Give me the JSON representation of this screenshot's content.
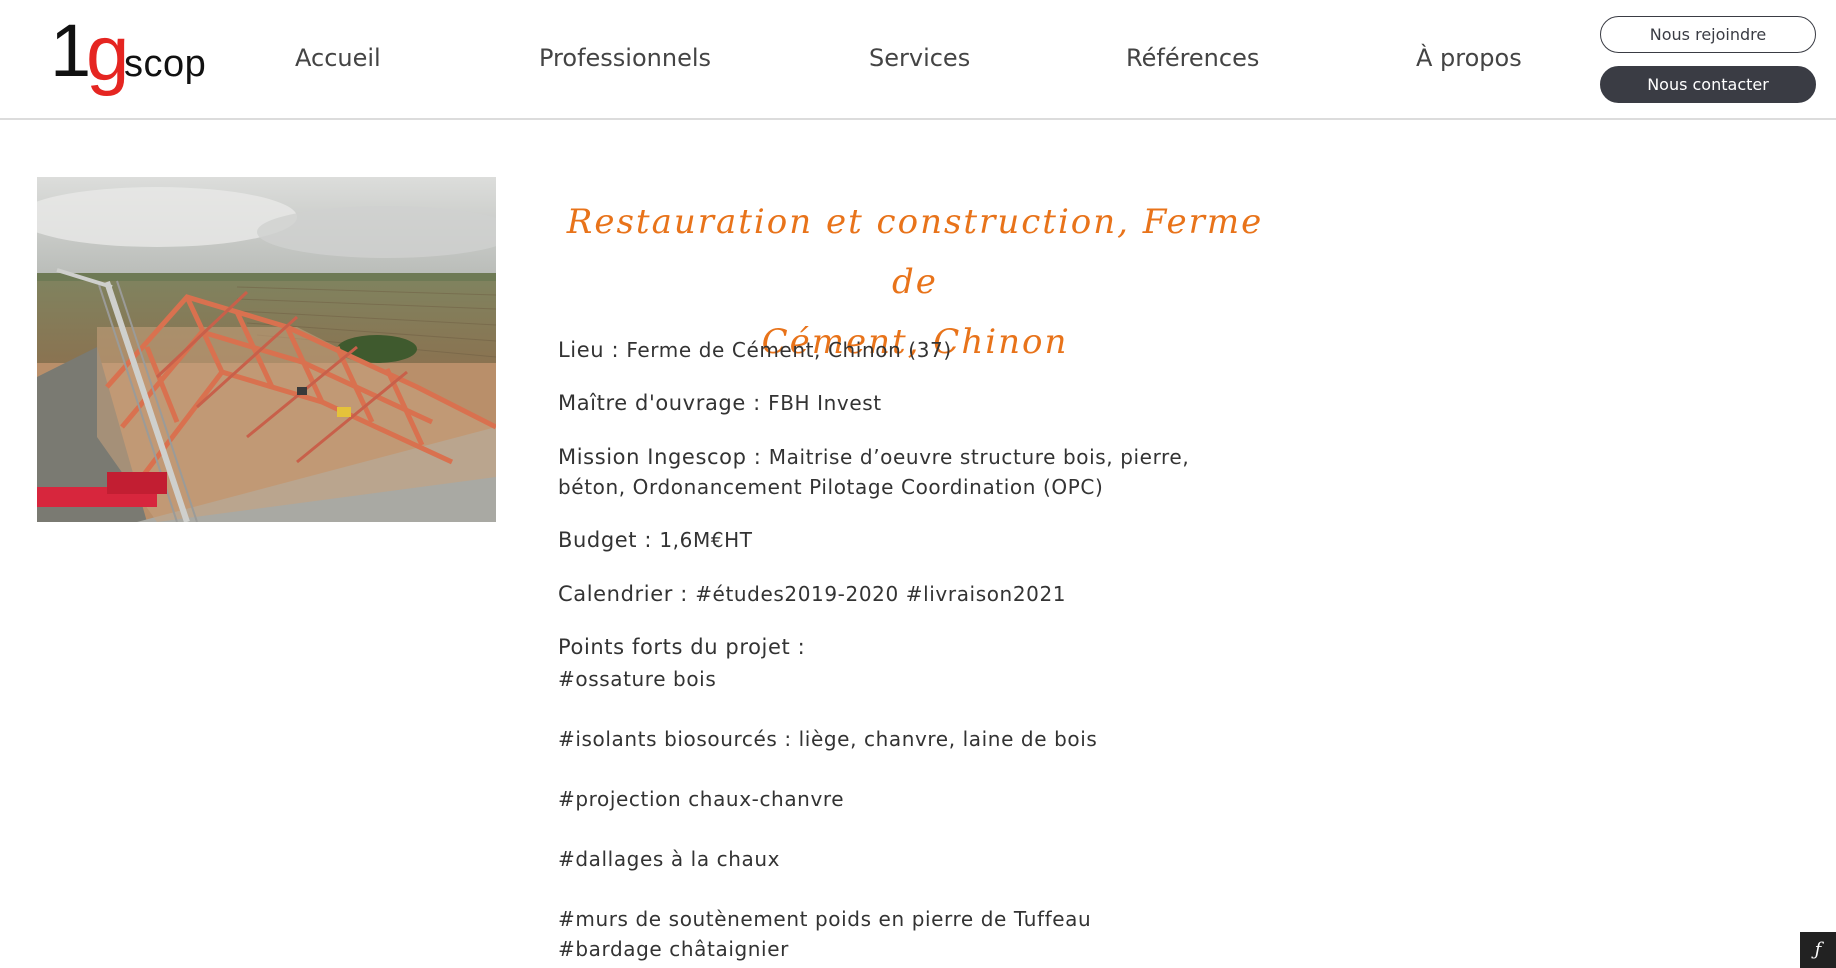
{
  "logo": {
    "one": "1",
    "g": "g",
    "scop": "scop"
  },
  "nav": {
    "items": [
      "Accueil",
      "Professionnels",
      "Services",
      "Références",
      "À propos"
    ]
  },
  "buttons": {
    "join": "Nous rejoindre",
    "contact": "Nous contacter"
  },
  "project": {
    "title_line1": "Restauration et construction, Ferme de",
    "title_line2": "Cément, Chinon",
    "lieu_label": "Lieu : ",
    "lieu_value": "Ferme de Cément, Chinon (37)",
    "moa_label": "Maître d'ouvrage : ",
    "moa_value": "FBH Invest",
    "mission_label": "Mission Ingescop : ",
    "mission_value": "Maitrise d’oeuvre structure bois, pierre, béton, Ordonancement Pilotage Coordination (OPC)",
    "budget_label": "Budget : ",
    "budget_value": "1,6M€HT",
    "calendar_label": "Calendrier : ",
    "calendar_value": "#études2019-2020 #livraison2021",
    "highlights_label": "Points forts du projet :",
    "highlights": [
      "#ossature bois",
      "#isolants biosourcés : liège, chanvre, laine de bois",
      "#projection chaux-chanvre",
      "#dallages à la chaux",
      "#murs de soutènement poids en pierre de Tuffeau",
      "#bardage châtaignier"
    ]
  },
  "colors": {
    "accent": "#e8731a",
    "logo_red": "#e52521",
    "button_dark": "#3a3c44"
  },
  "icons": {
    "debug_badge": "symfony-icon"
  }
}
